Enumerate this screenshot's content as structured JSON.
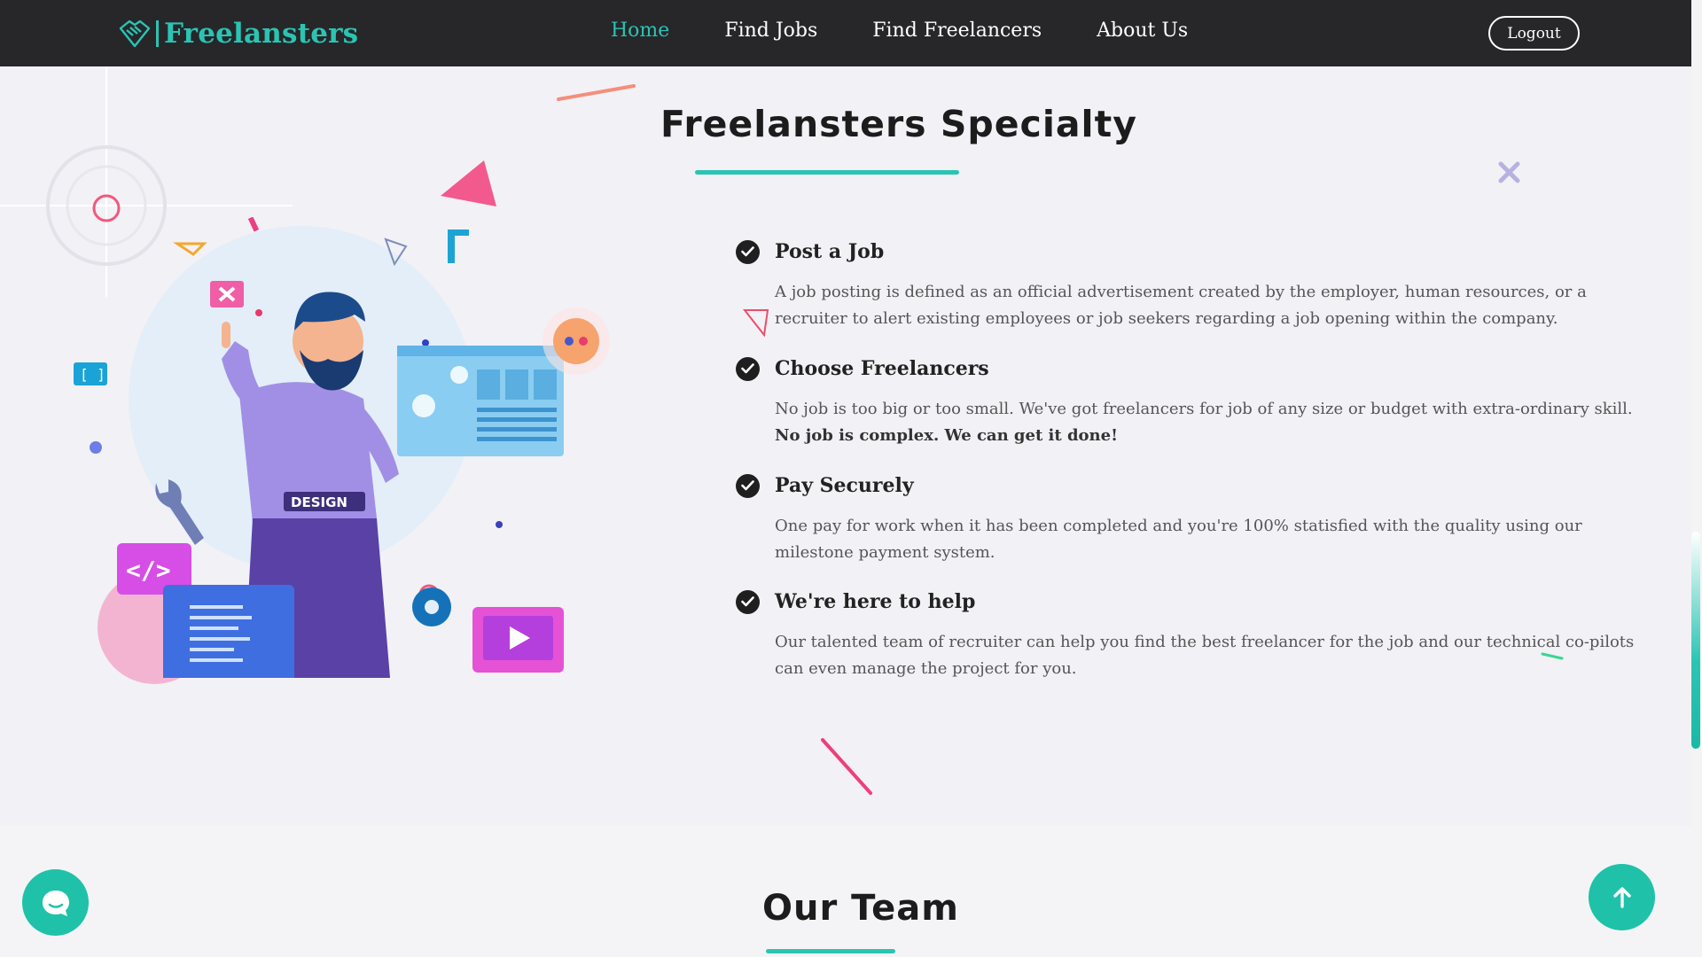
{
  "brand": {
    "name": "Freelansters",
    "icon": "handshake-icon",
    "color": "#2bc4b3"
  },
  "nav": {
    "items": [
      {
        "label": "Home",
        "active": true
      },
      {
        "label": "Find Jobs",
        "active": false
      },
      {
        "label": "Find Freelancers",
        "active": false
      },
      {
        "label": "About Us",
        "active": false
      }
    ],
    "logout_label": "Logout"
  },
  "specialty": {
    "title": "Freelansters Specialty",
    "features": [
      {
        "title": "Post a Job",
        "desc": "A job posting is defined as an official advertisement created by the employer, human resources, or a recruiter to alert existing employees or job seekers regarding a job opening within the company.",
        "icon": "check-circle-icon"
      },
      {
        "title": "Choose Freelancers",
        "desc": "No job is too big or too small. We've got freelancers for job of any size or budget with extra-ordinary skill.",
        "desc_bold": "No job is complex. We can get it done!",
        "icon": "check-circle-icon"
      },
      {
        "title": "Pay Securely",
        "desc": "One pay for work when it has been completed and you're 100% statisfied with the quality using our milestone payment system.",
        "icon": "check-circle-icon"
      },
      {
        "title": "We're here to help",
        "desc": "Our talented team of recruiter can help you find the best freelancer for the job and our technical co-pilots can even manage the project for you.",
        "icon": "check-circle-icon"
      }
    ],
    "illustration": {
      "shirt_text": "DESIGN"
    }
  },
  "team": {
    "title": "Our Team"
  },
  "colors": {
    "accent": "#2bc4b3",
    "navbar": "#27272a",
    "fab": "#1fc2a8"
  }
}
